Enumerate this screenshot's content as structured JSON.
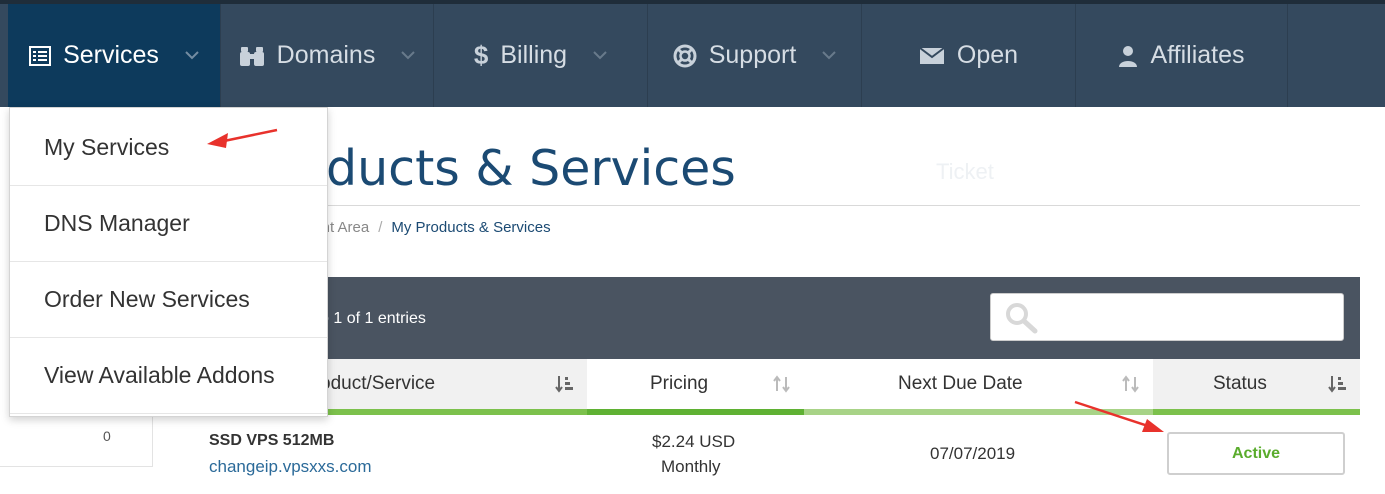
{
  "nav": {
    "items": [
      {
        "label": "Services",
        "icon": "list-icon",
        "dropdown": true,
        "active": true
      },
      {
        "label": "Domains",
        "icon": "binoculars-icon",
        "dropdown": true
      },
      {
        "label": "Billing",
        "icon": "dollar-icon",
        "dropdown": true
      },
      {
        "label": "Support",
        "icon": "lifebuoy-icon",
        "dropdown": true
      },
      {
        "label": "Open",
        "icon": "envelope-icon",
        "dropdown": false
      },
      {
        "label": "Affiliates",
        "icon": "user-icon",
        "dropdown": false
      }
    ],
    "ghost_label": "Ticket"
  },
  "dropdown": {
    "items": [
      {
        "label": "My Services"
      },
      {
        "label": "DNS Manager"
      },
      {
        "label": "Order New Services"
      },
      {
        "label": "View Available Addons"
      }
    ]
  },
  "page": {
    "title": "oducts & Services",
    "breadcrumb": {
      "parent": "ient Area",
      "separator": "/",
      "current": "My Products & Services"
    }
  },
  "sidebar": {
    "count": "0"
  },
  "table": {
    "entries_text": "o 1 of 1 entries",
    "search_placeholder": "",
    "columns": [
      {
        "label": "oduct/Service",
        "sort": "sorted"
      },
      {
        "label": "Pricing",
        "sort": "unsorted"
      },
      {
        "label": "Next Due Date",
        "sort": "unsorted"
      },
      {
        "label": "Status",
        "sort": "sorted"
      }
    ],
    "rows": [
      {
        "product": "SSD VPS 512MB",
        "domain": "changeip.vpsxxs.com",
        "price": "$2.24 USD",
        "cycle": "Monthly",
        "due_date": "07/07/2019",
        "status": "Active"
      }
    ]
  },
  "colors": {
    "nav_bg": "#34495e",
    "nav_active": "#0d3a5c",
    "title": "#1b4a73",
    "status_active": "#5aac2c",
    "header_underline": "#7cc14c",
    "annotation_arrow": "#e8322c"
  }
}
